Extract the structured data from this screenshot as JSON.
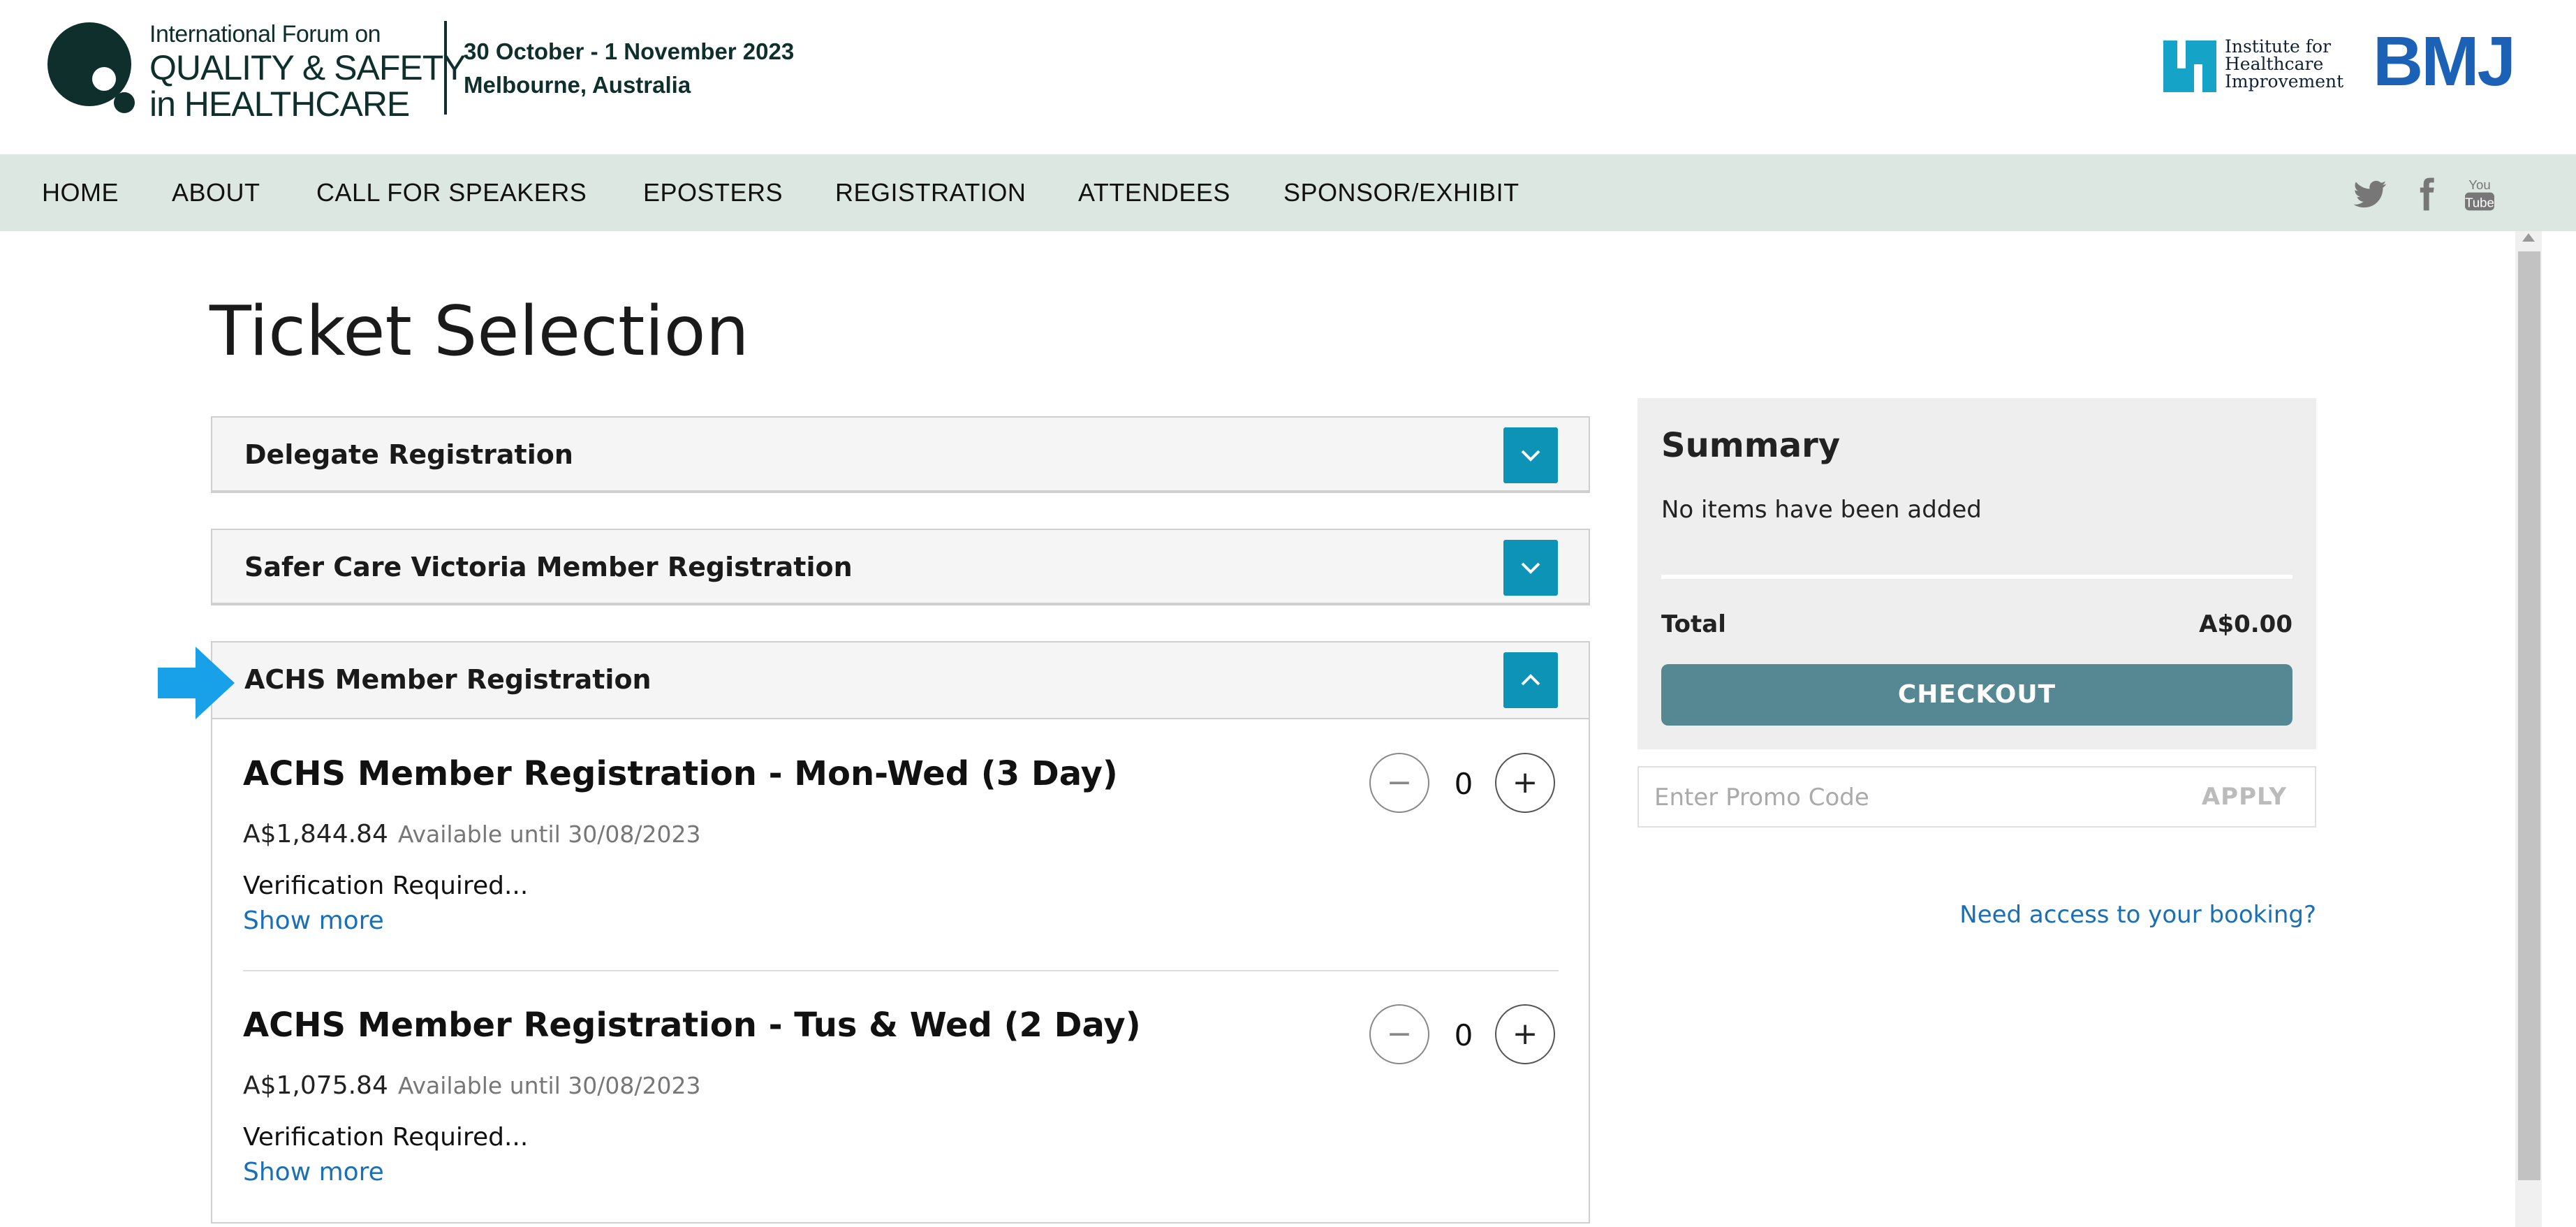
{
  "header": {
    "logo": {
      "line1": "International Forum on",
      "line2": "QUALITY & SAFETY",
      "line3": "in HEALTHCARE"
    },
    "event_dates": "30 October - 1 November 2023",
    "event_location": "Melbourne, Australia",
    "partner_logos": [
      {
        "name": "Institute for Healthcare Improvement",
        "text": "Institute for\nHealthcare\nImprovement"
      },
      {
        "name": "BMJ",
        "text": "BMJ"
      }
    ]
  },
  "nav": {
    "items": [
      "HOME",
      "ABOUT",
      "CALL FOR SPEAKERS",
      "EPOSTERS",
      "REGISTRATION",
      "ATTENDEES",
      "SPONSOR/EXHIBIT"
    ],
    "social": [
      "twitter-icon",
      "facebook-icon",
      "youtube-icon"
    ]
  },
  "page": {
    "title": "Ticket Selection"
  },
  "sections": [
    {
      "title": "Delegate Registration",
      "expanded": false
    },
    {
      "title": "Safer Care Victoria Member Registration",
      "expanded": false
    },
    {
      "title": "ACHS Member Registration",
      "expanded": true
    }
  ],
  "tickets": [
    {
      "name": "ACHS Member Registration - Mon-Wed (3 Day)",
      "price": "A$1,844.84",
      "availability": "Available until 30/08/2023",
      "description": "Verification Required...",
      "show_more": "Show more",
      "quantity": "0"
    },
    {
      "name": "ACHS Member Registration - Tus & Wed (2 Day)",
      "price": "A$1,075.84",
      "availability": "Available until 30/08/2023",
      "description": "Verification Required...",
      "show_more": "Show more",
      "quantity": "0"
    }
  ],
  "summary": {
    "title": "Summary",
    "empty_text": "No items have been added",
    "total_label": "Total",
    "total_value": "A$0.00",
    "checkout_label": "CHECKOUT"
  },
  "promo": {
    "placeholder": "Enter Promo Code",
    "apply_label": "APPLY"
  },
  "booking_link": "Need access to your booking?",
  "colors": {
    "nav_bg": "#dce7e1",
    "accent": "#0c93b5",
    "checkout": "#568893",
    "link": "#1a6fb5",
    "pointer_arrow": "#18a1e8"
  }
}
